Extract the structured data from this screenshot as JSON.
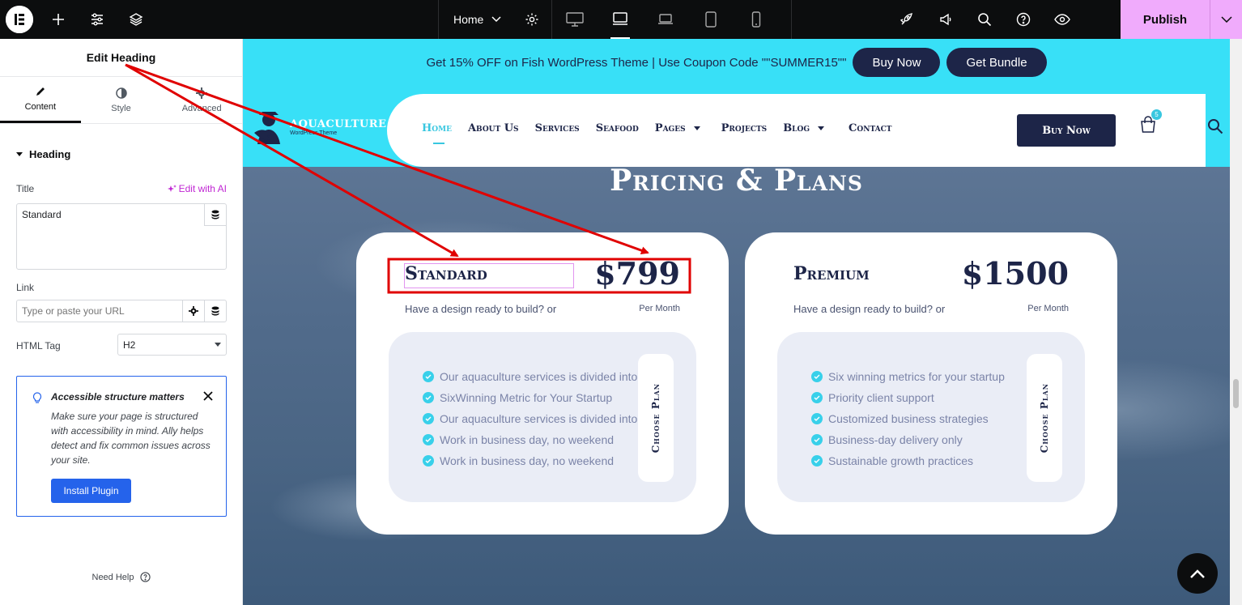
{
  "editor": {
    "page_name": "Home",
    "publish_label": "Publish"
  },
  "panel": {
    "title": "Edit Heading",
    "tabs": [
      {
        "label": "Content",
        "icon": "pencil-icon"
      },
      {
        "label": "Style",
        "icon": "contrast-icon"
      },
      {
        "label": "Advanced",
        "icon": "gear-icon"
      }
    ],
    "section": "Heading",
    "title_label": "Title",
    "edit_ai_label": "Edit with AI",
    "title_value": "Standard",
    "link_label": "Link",
    "link_placeholder": "Type or paste your URL",
    "html_tag_label": "HTML Tag",
    "html_tag_value": "H2",
    "notice": {
      "title": "Accessible structure matters",
      "body": "Make sure your page is structured with accessibility in mind. Ally helps detect and fix common issues across your site.",
      "button": "Install Plugin"
    },
    "need_help": "Need Help"
  },
  "site": {
    "promo_text": "Get 15% OFF on Fish WordPress Theme | Use Coupon Code \"\"SUMMER15\"\"",
    "promo_buy": "Buy Now",
    "promo_bundle": "Get Bundle",
    "logo_name": "AQUACULTURE",
    "logo_sub": "WordPress Theme",
    "nav": [
      "Home",
      "About Us",
      "Services",
      "Seafood",
      "Pages",
      "Projects",
      "Blog",
      "Contact"
    ],
    "nav_buy": "Buy Now",
    "cart_count": "5",
    "section_title": "Pricing & Plans",
    "plans": [
      {
        "name": "Standard",
        "price": "$799",
        "subtitle": "Have a design ready to build? or",
        "period": "Per Month",
        "features": [
          "Our aquaculture services is divided into",
          "SixWinning Metric for Your Startup",
          "Our aquaculture services is divided into",
          "Work in business day, no weekend",
          "Work in business day, no weekend"
        ],
        "cta": "Choose Plan"
      },
      {
        "name": "Premium",
        "price": "$1500",
        "subtitle": "Have a design ready to build? or",
        "period": "Per Month",
        "features": [
          "Six winning metrics for your startup",
          "Priority client support",
          "Customized business strategies",
          "Business-day delivery only",
          "Sustainable growth practices"
        ],
        "cta": "Choose Plan"
      }
    ]
  },
  "colors": {
    "accent": "#38e0f7",
    "navy": "#1d2548",
    "publish": "#f0abfc",
    "annotation": "#e00000"
  }
}
